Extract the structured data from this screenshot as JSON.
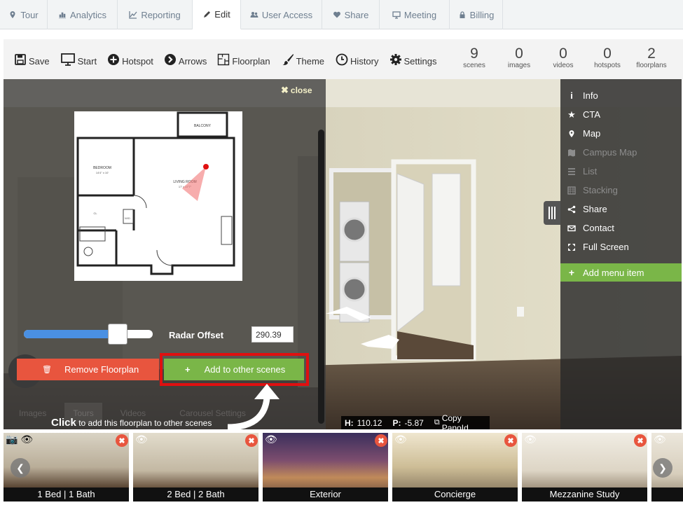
{
  "tabs": [
    {
      "label": "Tour",
      "icon": "map-marker-icon"
    },
    {
      "label": "Analytics",
      "icon": "bar-chart-icon"
    },
    {
      "label": "Reporting",
      "icon": "line-chart-icon"
    },
    {
      "label": "Edit",
      "icon": "pencil-icon",
      "active": true
    },
    {
      "label": "User Access",
      "icon": "users-icon"
    },
    {
      "label": "Share",
      "icon": "heart-icon"
    },
    {
      "label": "Meeting",
      "icon": "monitor-icon"
    },
    {
      "label": "Billing",
      "icon": "lock-icon"
    }
  ],
  "toolbar": {
    "save": "Save",
    "start": "Start",
    "hotspot": "Hotspot",
    "arrows": "Arrows",
    "floorplan": "Floorplan",
    "theme": "Theme",
    "history": "History",
    "settings": "Settings"
  },
  "stats": [
    {
      "value": "9",
      "label": "scenes"
    },
    {
      "value": "0",
      "label": "images"
    },
    {
      "value": "0",
      "label": "videos"
    },
    {
      "value": "0",
      "label": "hotspots"
    },
    {
      "value": "2",
      "label": "floorplans"
    }
  ],
  "floorplan_panel": {
    "close_label": "close",
    "radar_label": "Radar Offset",
    "radar_value": "290.39",
    "radar_slider_fraction": 0.73,
    "remove_label": "Remove Floorplan",
    "add_label": "Add to other scenes",
    "hint_bold": "Click",
    "hint_text": "to add this floorplan to other scenes",
    "room_labels": {
      "balcony": "BALCONY",
      "bedroom": "BEDROOM",
      "bedroom_dim": "14'4\" x 10'",
      "living": "LIVING ROOM",
      "living_dim": "17' x 17'7\"",
      "closet": "CL",
      "washer": "W/D"
    }
  },
  "bg_tabs": [
    "Images",
    "Tours",
    "Videos",
    "Carousel Settings"
  ],
  "menu": {
    "items": [
      {
        "label": "Info",
        "icon": "info-icon",
        "dim": false
      },
      {
        "label": "CTA",
        "icon": "star-icon",
        "dim": false
      },
      {
        "label": "Map",
        "icon": "map-marker-icon",
        "dim": false
      },
      {
        "label": "Campus Map",
        "icon": "map-icon",
        "dim": true
      },
      {
        "label": "List",
        "icon": "list-icon",
        "dim": true
      },
      {
        "label": "Stacking",
        "icon": "stacking-icon",
        "dim": true
      },
      {
        "label": "Share",
        "icon": "share-icon",
        "dim": false
      },
      {
        "label": "Contact",
        "icon": "envelope-icon",
        "dim": false
      },
      {
        "label": "Full Screen",
        "icon": "fullscreen-icon",
        "dim": false
      }
    ],
    "add_item": "Add menu item"
  },
  "status": {
    "h_label": "H:",
    "h_value": "110.12",
    "p_label": "P:",
    "p_value": "-5.87",
    "copy_label": "Copy PanoId"
  },
  "scenes": [
    {
      "label": "1 Bed | 1 Bath",
      "color": "#8c7f6f"
    },
    {
      "label": "2 Bed | 2 Bath",
      "color": "#9b8f80"
    },
    {
      "label": "Exterior",
      "color": "#5a3e5e"
    },
    {
      "label": "Concierge",
      "color": "#b8a88c"
    },
    {
      "label": "Mezzanine Study",
      "color": "#c9bfae"
    }
  ],
  "colors": {
    "green": "#7ab648",
    "red_button": "#e8553e",
    "highlight": "#e01010"
  }
}
